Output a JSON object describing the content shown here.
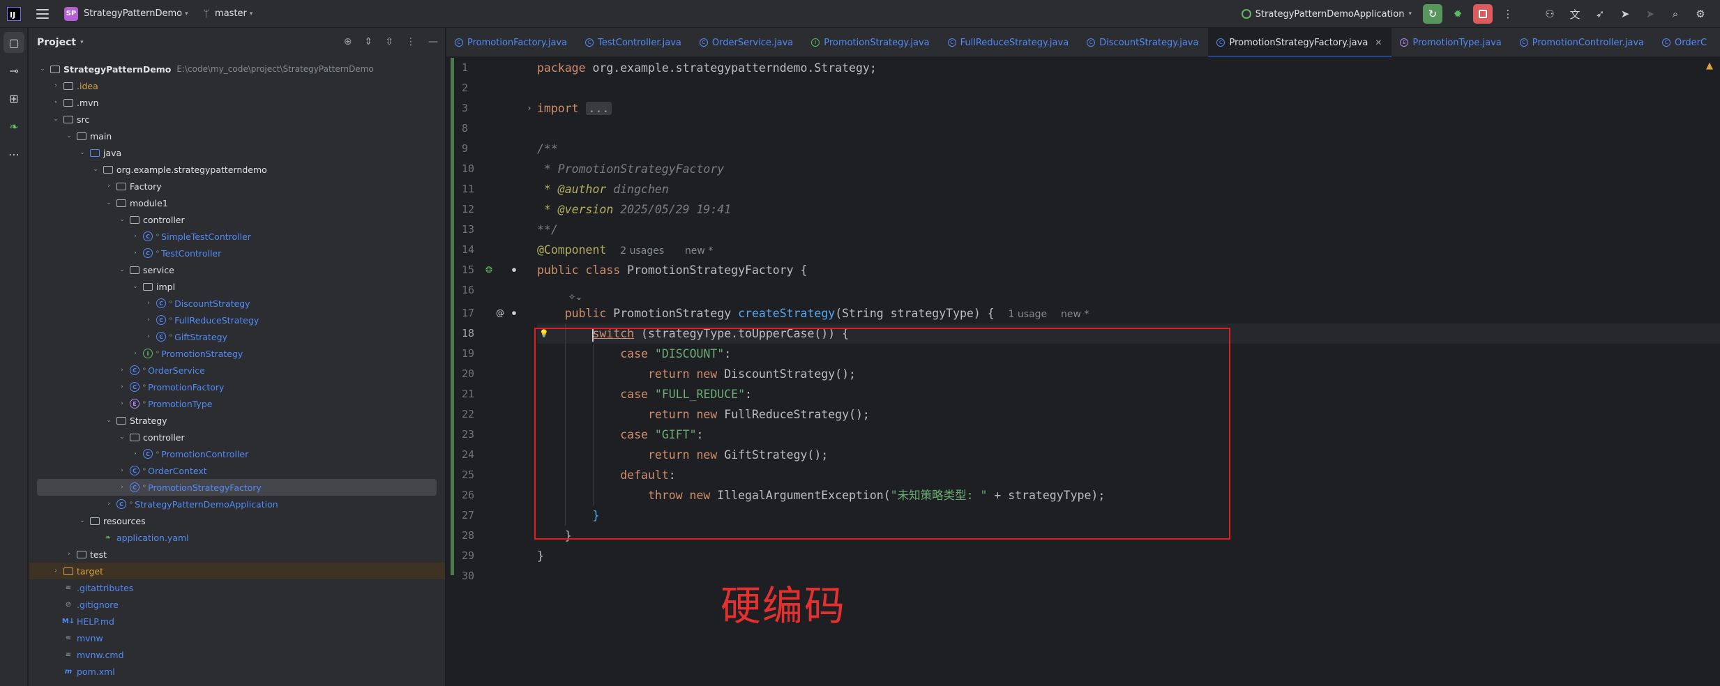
{
  "titlebar": {
    "logo_text": "IJ",
    "project_badge": "SP",
    "project_name": "StrategyPatternDemo",
    "branch": "master",
    "run_config": "StrategyPatternDemoApplication"
  },
  "project_panel": {
    "title": "Project",
    "root_name": "StrategyPatternDemo",
    "root_path": "E:\\code\\my_code\\project\\StrategyPatternDemo",
    "items": [
      {
        "label": "StrategyPatternDemo",
        "depth": 0,
        "arrow": "open",
        "icon": "folder",
        "bold": true
      },
      {
        "label": ".idea",
        "depth": 1,
        "arrow": "closed",
        "icon": "folder",
        "color": "orange"
      },
      {
        "label": ".mvn",
        "depth": 1,
        "arrow": "closed",
        "icon": "folder"
      },
      {
        "label": "src",
        "depth": 1,
        "arrow": "open",
        "icon": "folder"
      },
      {
        "label": "main",
        "depth": 2,
        "arrow": "open",
        "icon": "folder"
      },
      {
        "label": "java",
        "depth": 3,
        "arrow": "open",
        "icon": "folder-blue"
      },
      {
        "label": "org.example.strategypatterndemo",
        "depth": 4,
        "arrow": "open",
        "icon": "package"
      },
      {
        "label": "Factory",
        "depth": 5,
        "arrow": "closed",
        "icon": "package"
      },
      {
        "label": "module1",
        "depth": 5,
        "arrow": "open",
        "icon": "package"
      },
      {
        "label": "controller",
        "depth": 6,
        "arrow": "open",
        "icon": "package"
      },
      {
        "label": "SimpleTestController",
        "depth": 7,
        "arrow": "closed",
        "icon": "class",
        "color": "blue"
      },
      {
        "label": "TestController",
        "depth": 7,
        "arrow": "closed",
        "icon": "class",
        "color": "blue"
      },
      {
        "label": "service",
        "depth": 6,
        "arrow": "open",
        "icon": "package"
      },
      {
        "label": "impl",
        "depth": 7,
        "arrow": "open",
        "icon": "package"
      },
      {
        "label": "DiscountStrategy",
        "depth": 8,
        "arrow": "closed",
        "icon": "class",
        "color": "blue"
      },
      {
        "label": "FullReduceStrategy",
        "depth": 8,
        "arrow": "closed",
        "icon": "class",
        "color": "blue"
      },
      {
        "label": "GiftStrategy",
        "depth": 8,
        "arrow": "closed",
        "icon": "class",
        "color": "blue"
      },
      {
        "label": "PromotionStrategy",
        "depth": 7,
        "arrow": "closed",
        "icon": "interface",
        "color": "blue"
      },
      {
        "label": "OrderService",
        "depth": 6,
        "arrow": "closed",
        "icon": "class",
        "color": "blue"
      },
      {
        "label": "PromotionFactory",
        "depth": 6,
        "arrow": "closed",
        "icon": "class",
        "color": "blue"
      },
      {
        "label": "PromotionType",
        "depth": 6,
        "arrow": "closed",
        "icon": "enum",
        "color": "blue"
      },
      {
        "label": "Strategy",
        "depth": 5,
        "arrow": "open",
        "icon": "package"
      },
      {
        "label": "controller",
        "depth": 6,
        "arrow": "open",
        "icon": "package"
      },
      {
        "label": "PromotionController",
        "depth": 7,
        "arrow": "closed",
        "icon": "class",
        "color": "blue"
      },
      {
        "label": "OrderContext",
        "depth": 6,
        "arrow": "closed",
        "icon": "class",
        "color": "blue"
      },
      {
        "label": "PromotionStrategyFactory",
        "depth": 6,
        "arrow": "closed",
        "icon": "class",
        "color": "blue",
        "selected": true
      },
      {
        "label": "StrategyPatternDemoApplication",
        "depth": 5,
        "arrow": "closed",
        "icon": "app",
        "color": "blue"
      },
      {
        "label": "resources",
        "depth": 3,
        "arrow": "open",
        "icon": "folder"
      },
      {
        "label": "application.yaml",
        "depth": 4,
        "arrow": "none",
        "icon": "yaml",
        "color": "blue"
      },
      {
        "label": "test",
        "depth": 2,
        "arrow": "closed",
        "icon": "folder"
      },
      {
        "label": "target",
        "depth": 1,
        "arrow": "closed",
        "icon": "folder-orange",
        "color": "orange",
        "target": true
      },
      {
        "label": ".gitattributes",
        "depth": 1,
        "arrow": "none",
        "icon": "file",
        "color": "blue"
      },
      {
        "label": ".gitignore",
        "depth": 1,
        "arrow": "none",
        "icon": "ignore",
        "color": "blue"
      },
      {
        "label": "HELP.md",
        "depth": 1,
        "arrow": "none",
        "icon": "md",
        "color": "blue"
      },
      {
        "label": "mvnw",
        "depth": 1,
        "arrow": "none",
        "icon": "file",
        "color": "blue"
      },
      {
        "label": "mvnw.cmd",
        "depth": 1,
        "arrow": "none",
        "icon": "file",
        "color": "blue"
      },
      {
        "label": "pom.xml",
        "depth": 1,
        "arrow": "none",
        "icon": "maven",
        "color": "blue"
      }
    ]
  },
  "tabs": [
    {
      "label": "PromotionFactory.java",
      "icon": "C"
    },
    {
      "label": "TestController.java",
      "icon": "C"
    },
    {
      "label": "OrderService.java",
      "icon": "C"
    },
    {
      "label": "PromotionStrategy.java",
      "icon": "I"
    },
    {
      "label": "FullReduceStrategy.java",
      "icon": "C"
    },
    {
      "label": "DiscountStrategy.java",
      "icon": "C"
    },
    {
      "label": "PromotionStrategyFactory.java",
      "icon": "C",
      "active": true
    },
    {
      "label": "PromotionType.java",
      "icon": "E"
    },
    {
      "label": "PromotionController.java",
      "icon": "C"
    },
    {
      "label": "OrderC",
      "icon": "C"
    }
  ],
  "editor": {
    "line_numbers": [
      "1",
      "2",
      "3",
      "8",
      "9",
      "10",
      "11",
      "12",
      "13",
      "14",
      "15",
      "16",
      "17",
      "18",
      "19",
      "20",
      "21",
      "22",
      "23",
      "24",
      "25",
      "26",
      "27",
      "28",
      "29",
      "30"
    ],
    "current_line": "18",
    "hints": {
      "component_usages": "2 usages",
      "component_new": "new *",
      "method_usages": "1 usage",
      "method_new": "new *"
    },
    "code": {
      "package_kw": "package",
      "package_name": " org.example.strategypatterndemo.Strategy;",
      "import_kw": "import",
      "import_fold": "...",
      "doc_open": "/**",
      "doc_title": " * PromotionStrategyFactory",
      "doc_author_tag": " * @author",
      "doc_author": " dingchen",
      "doc_version_tag": " * @version",
      "doc_version": " 2025/05/29 19:41",
      "doc_close": "**/",
      "annotation": "@Component",
      "class_decl_kw": "public class",
      "class_name": " PromotionStrategyFactory {",
      "method_kw": "public",
      "method_type": " PromotionStrategy ",
      "method_name": "createStrategy",
      "method_params": "(String strategyType) {",
      "switch_kw": "switch",
      "switch_expr": " (strategyType.toUpperCase()) {",
      "case_kw": "case",
      "case1": "\"DISCOUNT\"",
      "case2": "\"FULL_REDUCE\"",
      "case3": "\"GIFT\"",
      "colon": ":",
      "return_new": "return new",
      "ret1": " DiscountStrategy();",
      "ret2": " FullReduceStrategy();",
      "ret3": " GiftStrategy();",
      "default_kw": "default",
      "throw_new": "throw new",
      "exception": " IllegalArgumentException(",
      "exception_msg": "\"未知策略类型: \"",
      "exception_tail": " + strategyType);",
      "close_brace": "}"
    }
  },
  "overlay_note": "硬编码",
  "colors": {
    "accent": "#3574f0",
    "keyword": "#cf8e6d",
    "string": "#6aab73",
    "function": "#56a8f5",
    "annotation_box": "#e02020"
  }
}
